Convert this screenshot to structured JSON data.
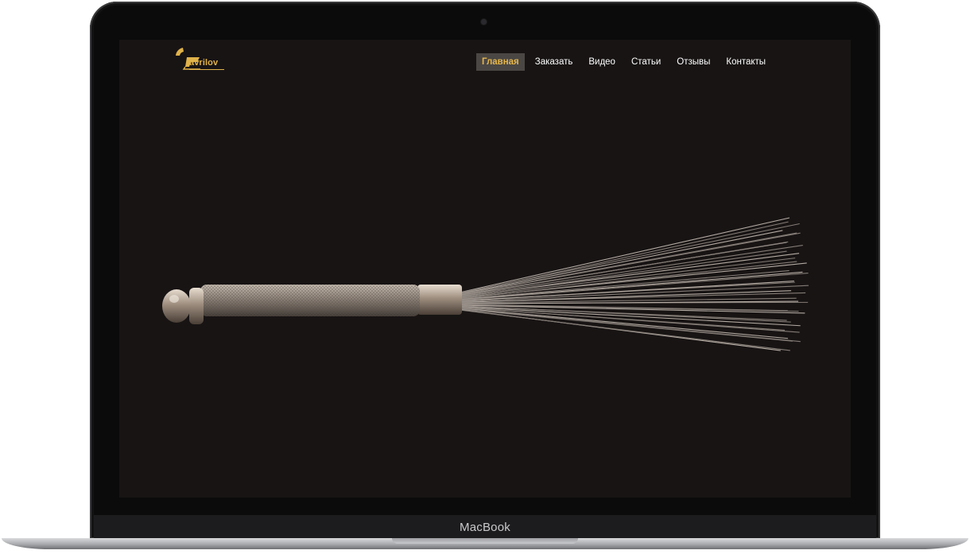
{
  "device": {
    "brand": "MacBook"
  },
  "site": {
    "logo_text": "avrilov",
    "accent_color": "#e0b24a",
    "background_color": "#181414",
    "nav": [
      {
        "label": "Главная",
        "active": true
      },
      {
        "label": "Заказать",
        "active": false
      },
      {
        "label": "Видео",
        "active": false
      },
      {
        "label": "Статьи",
        "active": false
      },
      {
        "label": "Отзывы",
        "active": false
      },
      {
        "label": "Контакты",
        "active": false
      }
    ]
  },
  "hero": {
    "image": "wire-brush-photo"
  }
}
